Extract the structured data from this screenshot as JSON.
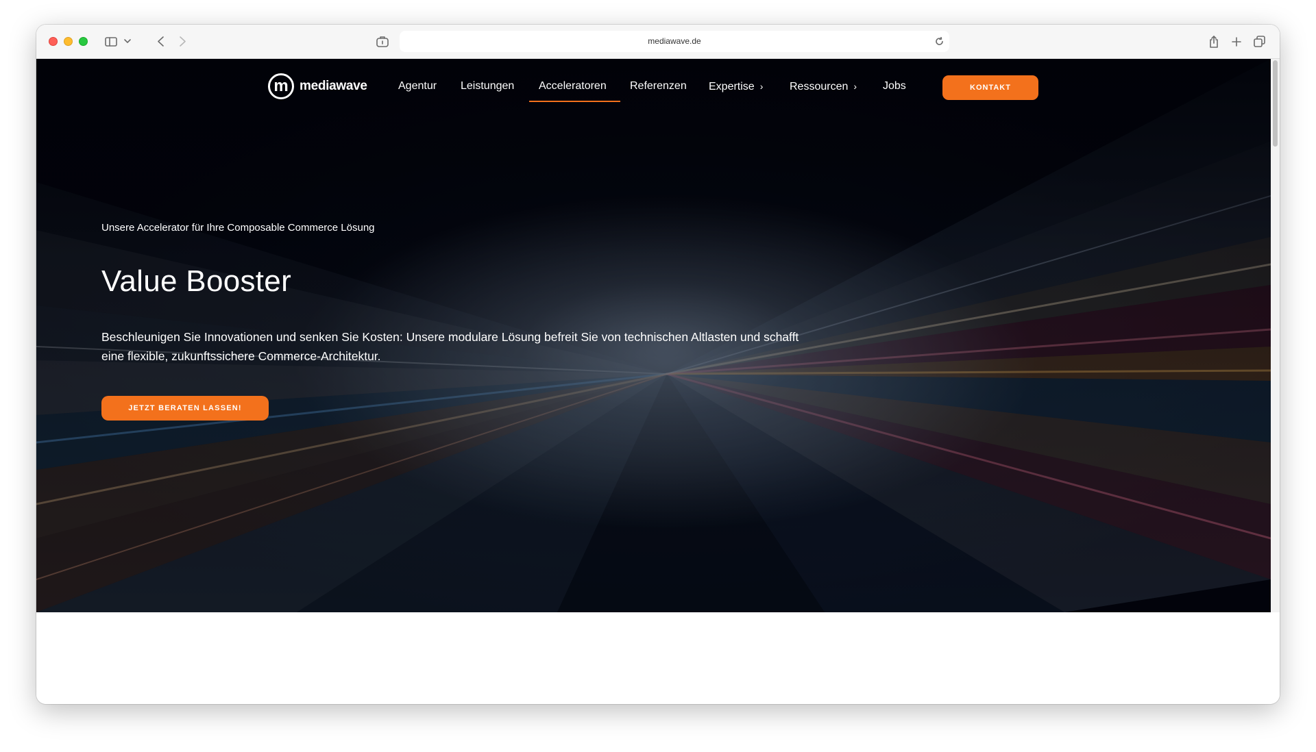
{
  "browser": {
    "url": "mediawave.de",
    "icons": [
      "sidebar-icon",
      "chevron-down-icon",
      "back-icon",
      "forward-icon",
      "extensions-icon",
      "reader-icon",
      "reload-icon",
      "share-icon",
      "new-tab-icon",
      "tabs-overview-icon"
    ]
  },
  "nav": {
    "logo_letter": "m",
    "logo_text": "mediawave",
    "items": [
      {
        "label": "Agentur"
      },
      {
        "label": "Leistungen"
      },
      {
        "label": "Acceleratoren",
        "active": true
      },
      {
        "label": "Referenzen"
      },
      {
        "label": "Expertise",
        "has_submenu": true
      },
      {
        "label": "Ressourcen",
        "has_submenu": true
      },
      {
        "label": "Jobs"
      }
    ],
    "cta_label": "KONTAKT",
    "chevron": "›"
  },
  "hero": {
    "eyebrow": "Unsere Accelerator für Ihre Composable Commerce Lösung",
    "title": "Value Booster",
    "description": "Beschleunigen Sie Innovationen und senken Sie Kosten: Unsere modulare Lösung befreit Sie von technischen Altlasten und schafft eine flexible, zukunftssichere Commerce-Architektur.",
    "cta_label": "JETZT BERATEN LASSEN!"
  },
  "colors": {
    "accent": "#f3711c",
    "hero_bg": "#050816"
  }
}
